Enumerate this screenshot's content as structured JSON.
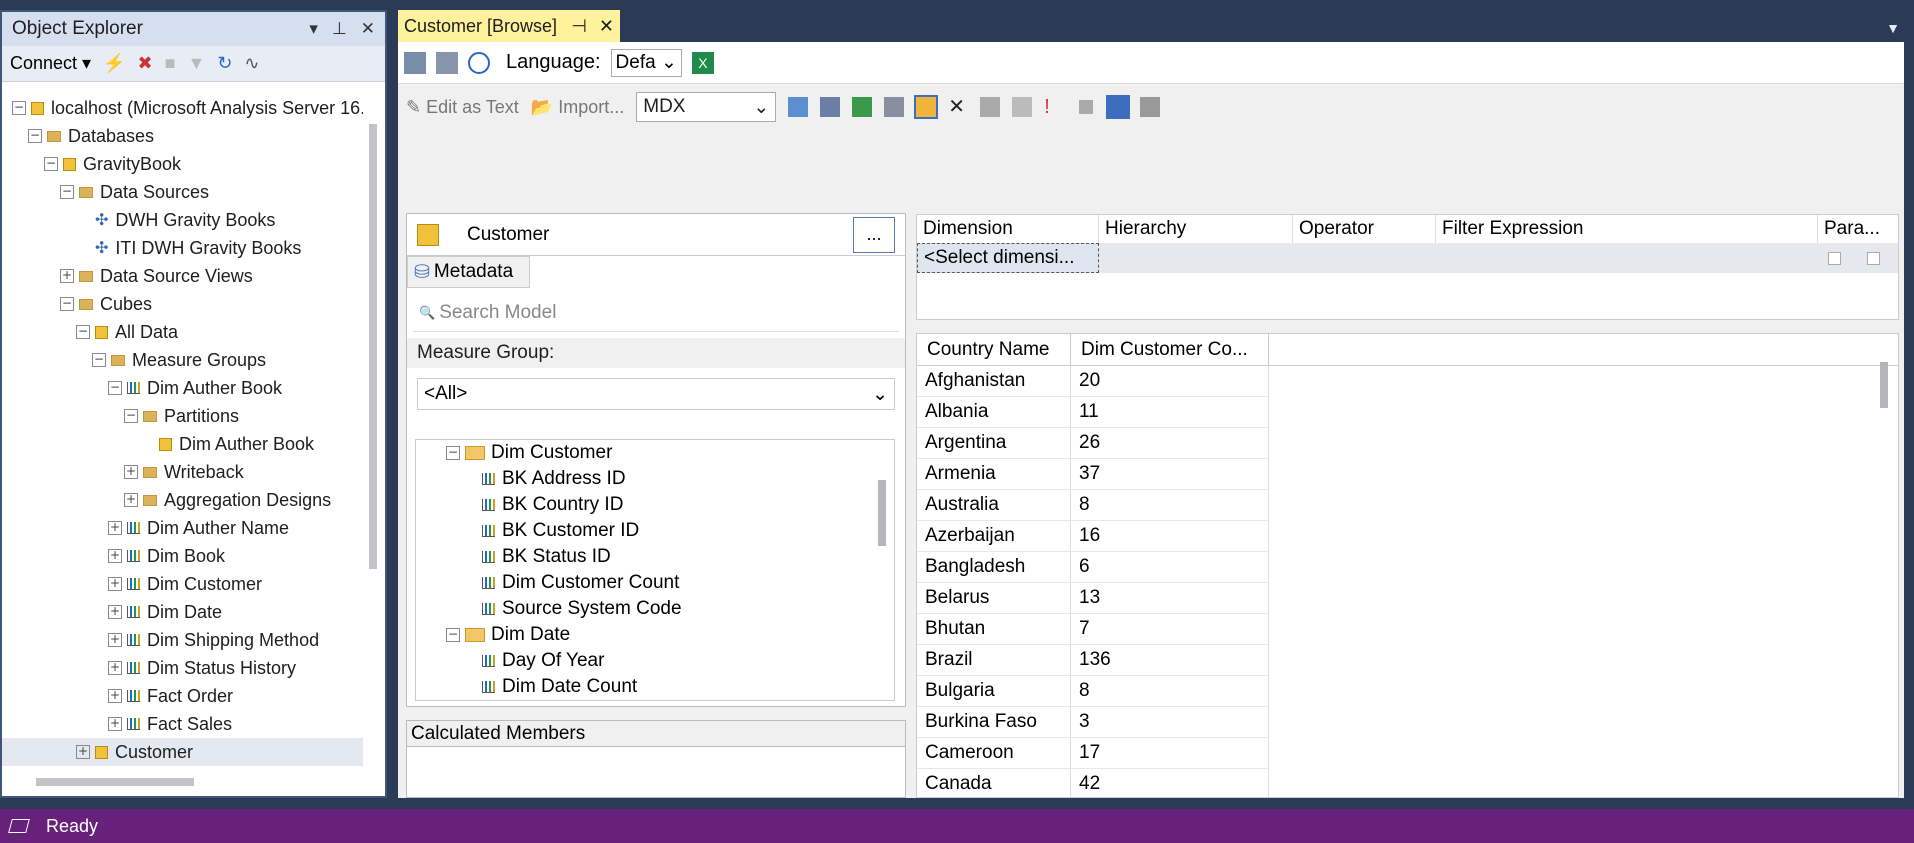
{
  "object_explorer": {
    "title": "Object Explorer",
    "connect_label": "Connect",
    "tree": [
      {
        "label": "localhost (Microsoft Analysis Server 16.",
        "depth": 0,
        "expander": "minus",
        "icon": "server"
      },
      {
        "label": "Databases",
        "depth": 1,
        "expander": "minus",
        "icon": "folder"
      },
      {
        "label": "GravityBook",
        "depth": 2,
        "expander": "minus",
        "icon": "database"
      },
      {
        "label": "Data Sources",
        "depth": 3,
        "expander": "minus",
        "icon": "folder"
      },
      {
        "label": "DWH Gravity Books",
        "depth": 4,
        "expander": "none",
        "icon": "datasource"
      },
      {
        "label": "ITI DWH Gravity Books",
        "depth": 4,
        "expander": "none",
        "icon": "datasource"
      },
      {
        "label": "Data Source Views",
        "depth": 3,
        "expander": "plus",
        "icon": "folder"
      },
      {
        "label": "Cubes",
        "depth": 3,
        "expander": "minus",
        "icon": "folder"
      },
      {
        "label": "All Data",
        "depth": 4,
        "expander": "minus",
        "icon": "cube"
      },
      {
        "label": "Measure Groups",
        "depth": 5,
        "expander": "minus",
        "icon": "folder"
      },
      {
        "label": "Dim Auther Book",
        "depth": 6,
        "expander": "minus",
        "icon": "measure"
      },
      {
        "label": "Partitions",
        "depth": 7,
        "expander": "minus",
        "icon": "folder"
      },
      {
        "label": "Dim Auther Book",
        "depth": 8,
        "expander": "none",
        "icon": "partition"
      },
      {
        "label": "Writeback",
        "depth": 7,
        "expander": "plus",
        "icon": "folder"
      },
      {
        "label": "Aggregation Designs",
        "depth": 7,
        "expander": "plus",
        "icon": "folder"
      },
      {
        "label": "Dim Auther Name",
        "depth": 6,
        "expander": "plus",
        "icon": "measure"
      },
      {
        "label": "Dim Book",
        "depth": 6,
        "expander": "plus",
        "icon": "measure"
      },
      {
        "label": "Dim Customer",
        "depth": 6,
        "expander": "plus",
        "icon": "measure"
      },
      {
        "label": "Dim Date",
        "depth": 6,
        "expander": "plus",
        "icon": "measure"
      },
      {
        "label": "Dim Shipping Method",
        "depth": 6,
        "expander": "plus",
        "icon": "measure"
      },
      {
        "label": "Dim Status History",
        "depth": 6,
        "expander": "plus",
        "icon": "measure"
      },
      {
        "label": "Fact Order",
        "depth": 6,
        "expander": "plus",
        "icon": "measure"
      },
      {
        "label": "Fact Sales",
        "depth": 6,
        "expander": "plus",
        "icon": "measure"
      },
      {
        "label": "Customer",
        "depth": 4,
        "expander": "plus",
        "icon": "cube",
        "selected": true
      }
    ]
  },
  "document": {
    "tab_title": "Customer [Browse]",
    "language_label": "Language:",
    "language_value": "Defa",
    "edit_as_text": "Edit as Text",
    "import_label": "Import...",
    "query_type": "MDX"
  },
  "metadata": {
    "cube_name": "Customer",
    "ellipsis": "...",
    "tab_label": "Metadata",
    "search_placeholder": "Search Model",
    "measure_group_label": "Measure Group:",
    "measure_group_value": "<All>",
    "tree": [
      {
        "label": "Dim Customer",
        "depth": 0,
        "expander": "minus",
        "icon": "folder-open"
      },
      {
        "label": "BK Address ID",
        "depth": 1,
        "icon": "measure"
      },
      {
        "label": "BK Country ID",
        "depth": 1,
        "icon": "measure"
      },
      {
        "label": "BK Customer ID",
        "depth": 1,
        "icon": "measure"
      },
      {
        "label": "BK Status ID",
        "depth": 1,
        "icon": "measure"
      },
      {
        "label": "Dim Customer Count",
        "depth": 1,
        "icon": "measure"
      },
      {
        "label": "Source System Code",
        "depth": 1,
        "icon": "measure"
      },
      {
        "label": "Dim Date",
        "depth": 0,
        "expander": "minus",
        "icon": "folder-open"
      },
      {
        "label": "Day Of Year",
        "depth": 1,
        "icon": "measure"
      },
      {
        "label": "Dim Date Count",
        "depth": 1,
        "icon": "measure"
      }
    ],
    "calculated_members_label": "Calculated Members"
  },
  "filter": {
    "columns": [
      "Dimension",
      "Hierarchy",
      "Operator",
      "Filter Expression",
      "Para..."
    ],
    "select_placeholder": "<Select dimensi..."
  },
  "results": {
    "columns": [
      "Country Name",
      "Dim Customer Co..."
    ],
    "rows": [
      [
        "Afghanistan",
        "20"
      ],
      [
        "Albania",
        "11"
      ],
      [
        "Argentina",
        "26"
      ],
      [
        "Armenia",
        "37"
      ],
      [
        "Australia",
        "8"
      ],
      [
        "Azerbaijan",
        "16"
      ],
      [
        "Bangladesh",
        "6"
      ],
      [
        "Belarus",
        "13"
      ],
      [
        "Bhutan",
        "7"
      ],
      [
        "Brazil",
        "136"
      ],
      [
        "Bulgaria",
        "8"
      ],
      [
        "Burkina Faso",
        "3"
      ],
      [
        "Cameroon",
        "17"
      ],
      [
        "Canada",
        "42"
      ]
    ]
  },
  "status": {
    "text": "Ready"
  },
  "colors": {
    "status_bar": "#68217a",
    "tab_active": "#fff29d",
    "chrome": "#2b3a57"
  }
}
